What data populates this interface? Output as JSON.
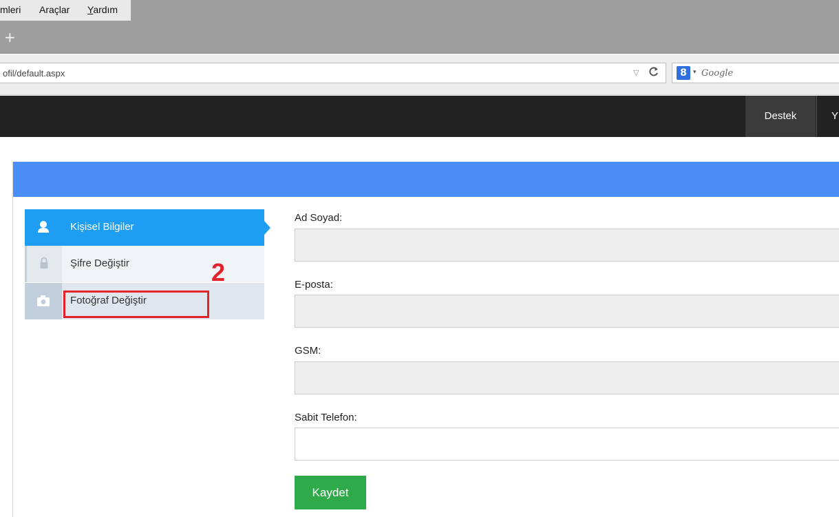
{
  "browser": {
    "menu_items": [
      "mleri",
      "Araçlar",
      "Yardım"
    ],
    "new_tab_symbol": "+",
    "url": "ofil/default.aspx",
    "dropdown_arrow": "▽",
    "reload_symbol": "C",
    "search_engine_icon": "8",
    "search_dropdown": "▾",
    "search_placeholder": "Google"
  },
  "header": {
    "nav_items": [
      "Destek",
      "Y"
    ]
  },
  "sidebar": {
    "items": [
      {
        "label": "Kişisel Bilgiler",
        "icon": "user-icon",
        "active": true
      },
      {
        "label": "Şifre Değiştir",
        "icon": "lock-icon",
        "active": false
      },
      {
        "label": "Fotoğraf Değiştir",
        "icon": "camera-icon",
        "active": false
      }
    ]
  },
  "annotation": {
    "step_number": "2",
    "color": "#e2232a"
  },
  "form": {
    "fields": [
      {
        "label": "Ad Soyad:",
        "value": ""
      },
      {
        "label": "E-posta:",
        "value": ""
      },
      {
        "label": "GSM:",
        "value": ""
      },
      {
        "label": "Sabit Telefon:",
        "value": ""
      }
    ],
    "submit_label": "Kaydet"
  },
  "colors": {
    "panel_header": "#4a8ff7",
    "active_item": "#1e9ef2",
    "header_bg": "#222222",
    "save_button": "#2eaa48"
  }
}
